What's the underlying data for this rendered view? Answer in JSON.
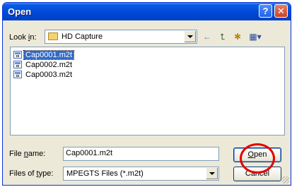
{
  "window": {
    "title": "Open",
    "help_glyph": "?",
    "close_glyph": "✕"
  },
  "lookin": {
    "label_prefix": "Look ",
    "label_accel": "i",
    "label_suffix": "n:",
    "folder": "HD Capture"
  },
  "toolbar": {
    "back": "←",
    "up": "⮤",
    "newfolder": "✱",
    "view": "▦▾"
  },
  "files": [
    {
      "name": "Cap0001.m2t",
      "selected": true
    },
    {
      "name": "Cap0002.m2t",
      "selected": false
    },
    {
      "name": "Cap0003.m2t",
      "selected": false
    }
  ],
  "filename": {
    "label_prefix": "File ",
    "label_accel": "n",
    "label_suffix": "ame:",
    "value": "Cap0001.m2t"
  },
  "filetype": {
    "label_prefix": "Files of ",
    "label_accel": "t",
    "label_suffix": "ype:",
    "value": "MPEGTS Files (*.m2t)"
  },
  "buttons": {
    "open_accel": "O",
    "open_rest": "pen",
    "cancel": "Cancel"
  },
  "colors": {
    "title_bar": "#0048d8",
    "highlight_ring": "#e50000",
    "selection": "#316ac5"
  }
}
